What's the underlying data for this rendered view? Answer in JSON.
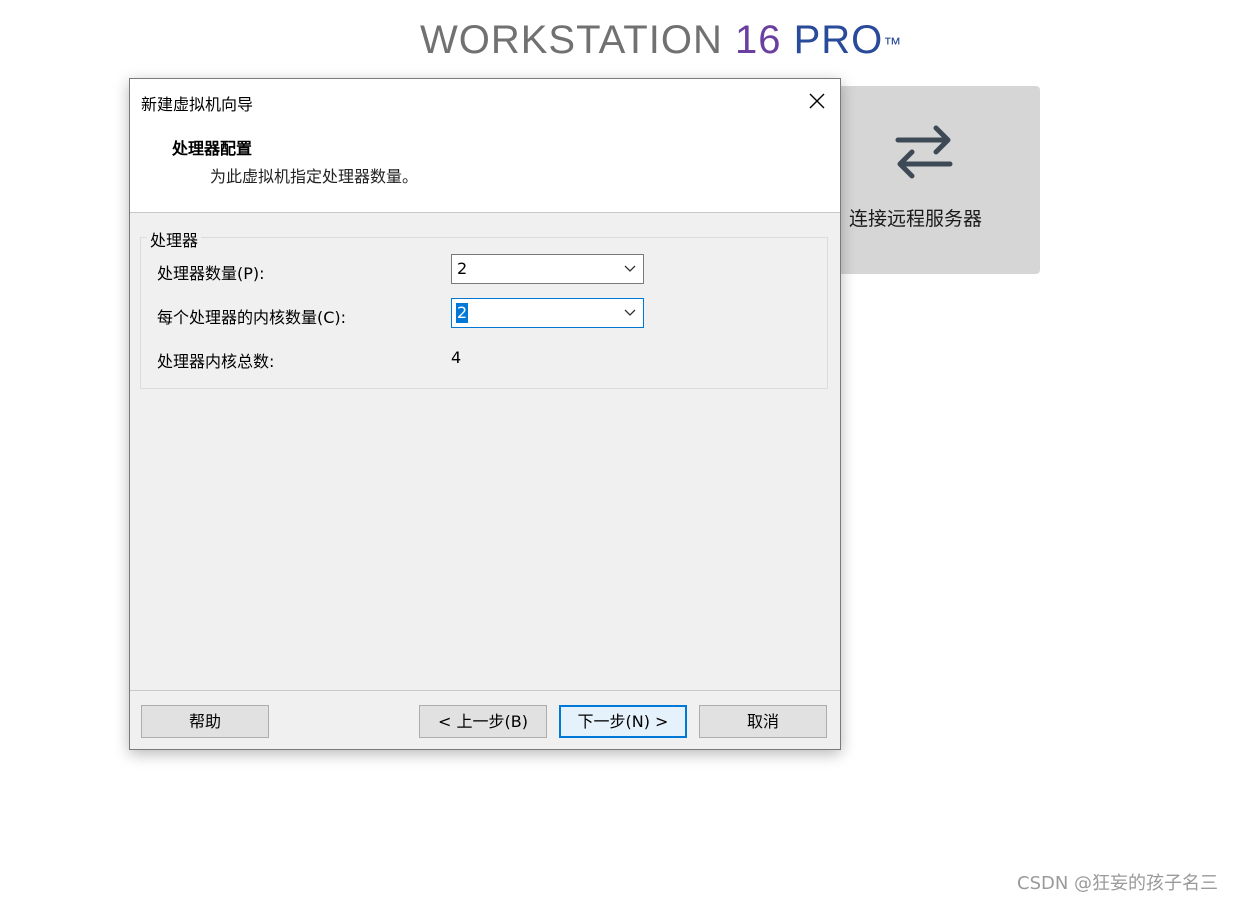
{
  "brand": {
    "word": "WORKSTATION",
    "number": "16",
    "edition": "PRO",
    "tm": "™"
  },
  "tile": {
    "icon": "swap-arrows-icon",
    "label": "连接远程服务器"
  },
  "dialog": {
    "title": "新建虚拟机向导",
    "step_title": "处理器配置",
    "step_desc": "为此虚拟机指定处理器数量。",
    "group_label": "处理器",
    "processors_label": "处理器数量(P):",
    "processors_value": "2",
    "cores_label": "每个处理器的内核数量(C):",
    "cores_value": "2",
    "total_label": "处理器内核总数:",
    "total_value": "4",
    "buttons": {
      "help": "帮助",
      "back": "< 上一步(B)",
      "next": "下一步(N) >",
      "cancel": "取消"
    }
  },
  "watermark": "CSDN @狂妄的孩子名三"
}
